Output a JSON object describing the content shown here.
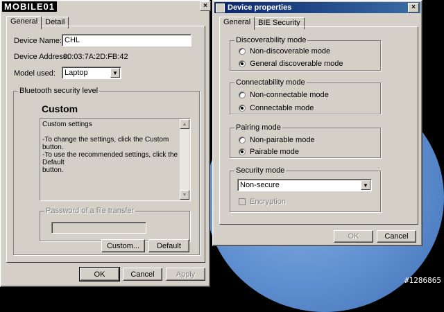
{
  "watermark": {
    "logo_text": "MOBILE01",
    "post_id": "#1286865"
  },
  "left_dialog": {
    "tabs": [
      "General",
      "Detail"
    ],
    "device_name_label": "Device Name:",
    "device_name_value": "CHL",
    "device_address_label": "Device Address:",
    "device_address_value": "00:03:7A:2D:FB:42",
    "model_label": "Model used:",
    "model_value": "Laptop",
    "security_group": "Bluetooth security level",
    "security_heading": "Custom",
    "description_lines": [
      "Custom settings",
      "",
      "-To change the settings, click the Custom button.",
      "-To use the recommended settings, click the Default",
      "button."
    ],
    "password_group": "Password of a file transfer",
    "custom_button": "Custom...",
    "default_button": "Default",
    "ok_button": "OK",
    "cancel_button": "Cancel",
    "apply_button": "Apply",
    "close_glyph": "×"
  },
  "right_dialog": {
    "title": "Device properties",
    "tabs": [
      "General",
      "BIE Security"
    ],
    "discoverability": {
      "title": "Discoverability mode",
      "options": [
        "Non-discoverable mode",
        "General discoverable mode"
      ],
      "selected": "General discoverable mode"
    },
    "connectability": {
      "title": "Connectability mode",
      "options": [
        "Non-connectable mode",
        "Connectable mode"
      ],
      "selected": "Connectable mode"
    },
    "pairing": {
      "title": "Pairing mode",
      "options": [
        "Non-pairable mode",
        "Pairable mode"
      ],
      "selected": "Pairable mode"
    },
    "security": {
      "title": "Security mode",
      "value": "Non-secure",
      "encryption_label": "Encryption",
      "encryption_checked": false
    },
    "ok_button": "OK",
    "cancel_button": "Cancel",
    "close_glyph": "×"
  }
}
